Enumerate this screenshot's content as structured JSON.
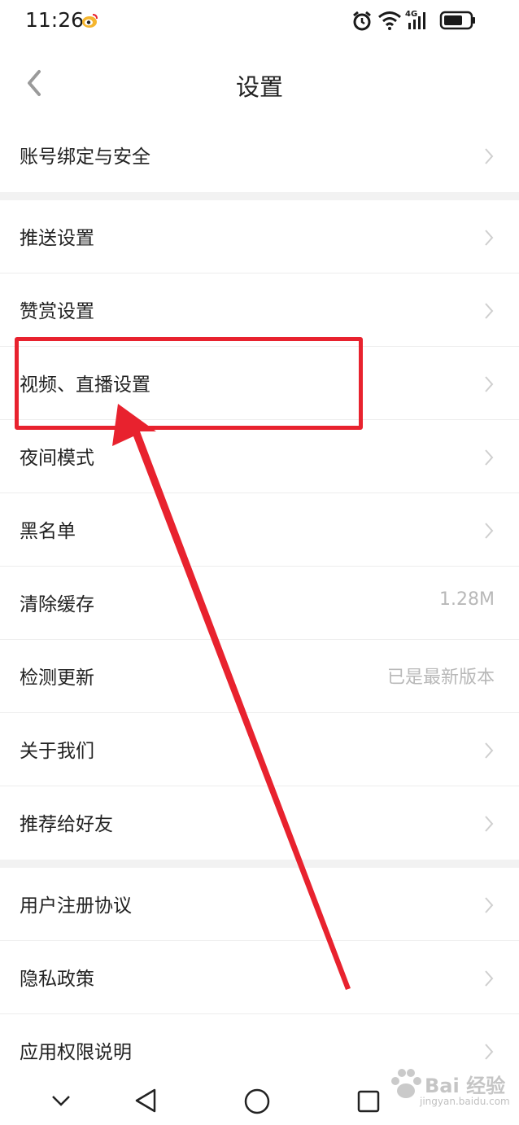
{
  "status_bar": {
    "time": "11:26",
    "network_label": "4G"
  },
  "header": {
    "title": "设置"
  },
  "settings": [
    {
      "label": "账号绑定与安全",
      "value": "",
      "chevron": true
    },
    {
      "label": "推送设置",
      "value": "",
      "chevron": true
    },
    {
      "label": "赞赏设置",
      "value": "",
      "chevron": true
    },
    {
      "label": "视频、直播设置",
      "value": "",
      "chevron": true
    },
    {
      "label": "夜间模式",
      "value": "",
      "chevron": true
    },
    {
      "label": "黑名单",
      "value": "",
      "chevron": true
    },
    {
      "label": "清除缓存",
      "value": "1.28M",
      "chevron": false
    },
    {
      "label": "检测更新",
      "value": "已是最新版本",
      "chevron": false
    },
    {
      "label": "关于我们",
      "value": "",
      "chevron": true
    },
    {
      "label": "推荐给好友",
      "value": "",
      "chevron": true
    },
    {
      "label": "用户注册协议",
      "value": "",
      "chevron": true
    },
    {
      "label": "隐私政策",
      "value": "",
      "chevron": true
    },
    {
      "label": "应用权限说明",
      "value": "",
      "chevron": true
    }
  ],
  "watermark": {
    "brand": "Bai 经验",
    "domain": "jingyan.baidu.com"
  },
  "colors": {
    "annotation": "#e8222e",
    "divider": "#f2f2f2",
    "secondary_text": "#b8b8b8"
  },
  "icons": {
    "back": "chevron-left-icon",
    "row": "chevron-right-icon",
    "nav": [
      "chevron-down-icon",
      "triangle-back-icon",
      "circle-home-icon",
      "square-recent-icon"
    ]
  }
}
